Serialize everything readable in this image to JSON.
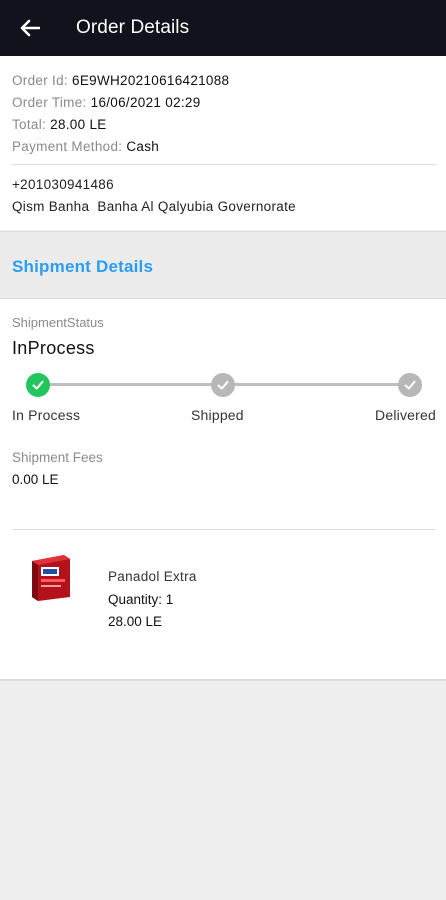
{
  "appbar": {
    "title": "Order Details",
    "back_icon": "arrow-left-icon"
  },
  "order": {
    "id_label": "Order Id:",
    "id_value": "6E9WH20210616421088",
    "time_label": "Order Time:",
    "time_value": "16/06/2021 02:29",
    "total_label": "Total:",
    "total_value": "28.00 LE",
    "payment_label": "Payment Method:",
    "payment_value": "Cash",
    "phone": "+201030941486",
    "address": "Qism Banha  Banha Al Qalyubia Governorate"
  },
  "shipment": {
    "section_title": "Shipment Details",
    "status_caption": "ShipmentStatus",
    "status_value": "InProcess",
    "steps": [
      {
        "label": "In Process",
        "state": "done"
      },
      {
        "label": "Shipped",
        "state": "pending"
      },
      {
        "label": "Delivered",
        "state": "pending"
      }
    ],
    "fees_caption": "Shipment Fees",
    "fees_value": "0.00 LE"
  },
  "product": {
    "name": "Panadol Extra",
    "quantity": "Quantity: 1",
    "price": "28.00 LE"
  },
  "colors": {
    "appbar": "#12121c",
    "accent": "#2a9df4",
    "done": "#22c55e",
    "pending": "#b7b7b7"
  }
}
